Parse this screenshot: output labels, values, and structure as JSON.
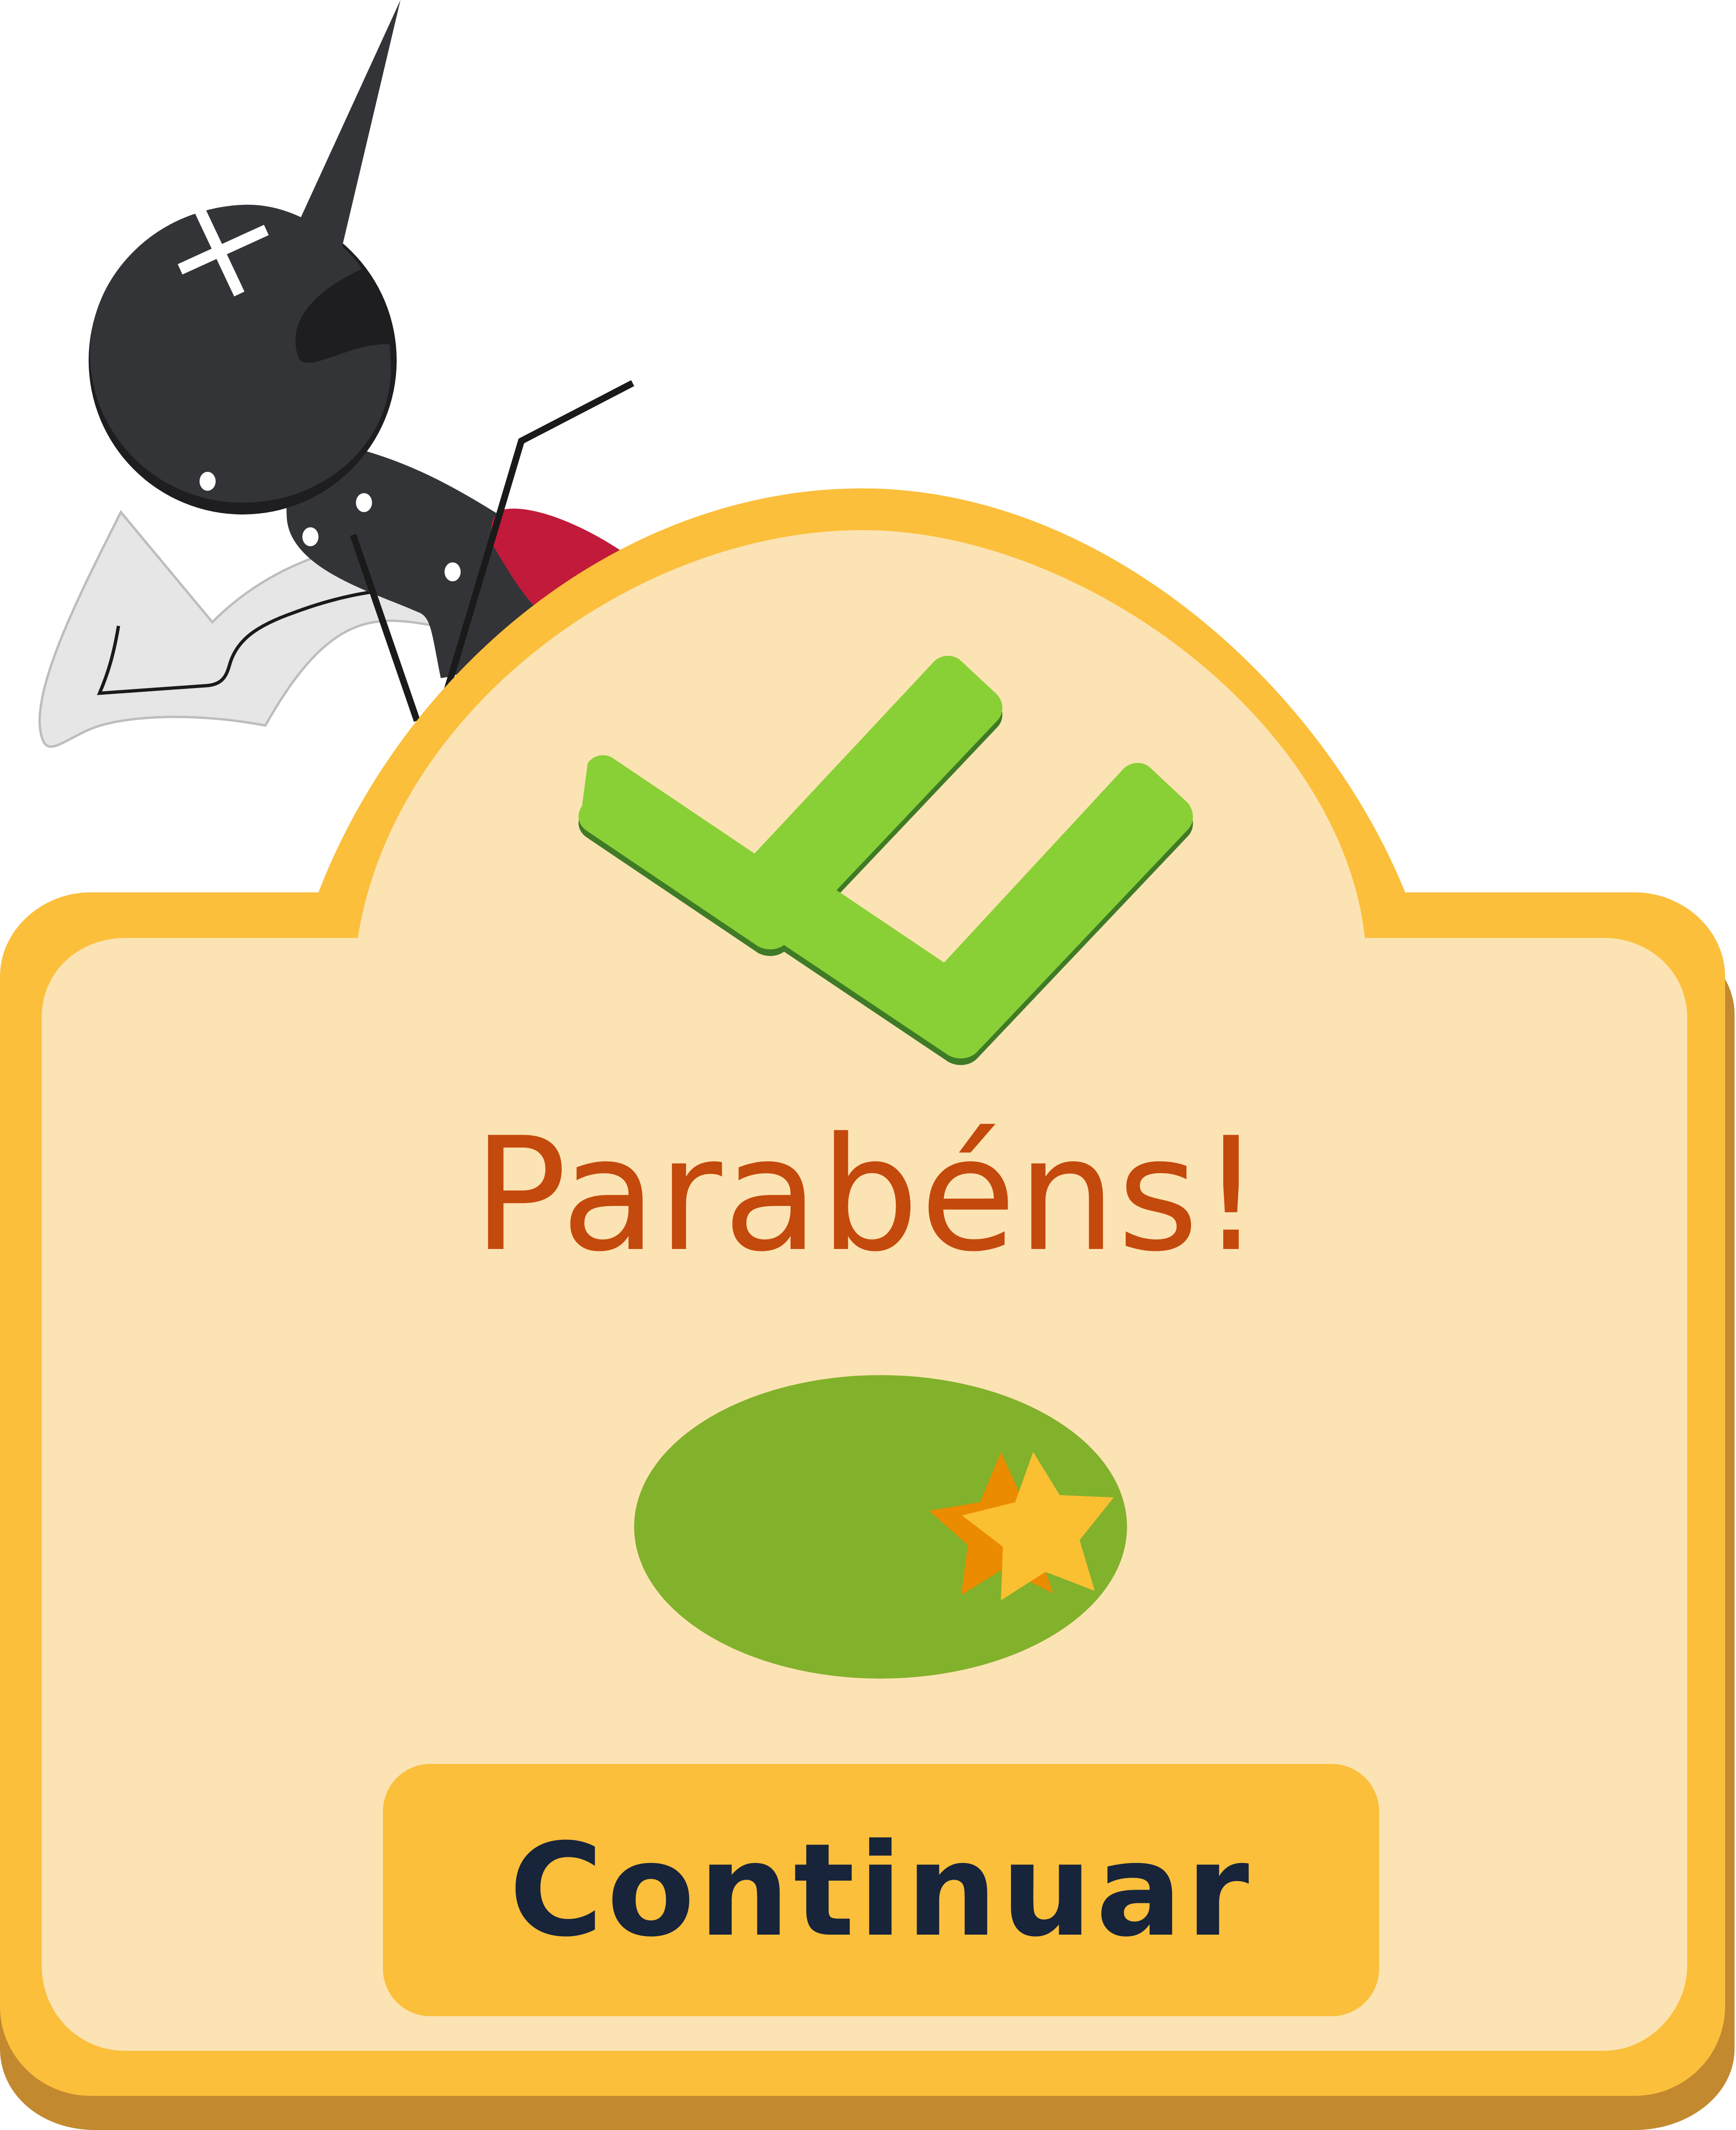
{
  "dialog": {
    "title": "Parabéns!",
    "continue_label": "Continuar"
  },
  "result": {
    "stars_earned": 2,
    "badge_color": "#82b12b",
    "star_colors": [
      "#eb8b00",
      "#fbbf32"
    ]
  },
  "colors": {
    "frame": "#fbbf3b",
    "frame_shadow": "#c2892f",
    "panel": "#fce3b3",
    "title": "#c4490c",
    "check": "#88d035",
    "check_shadow": "#3f7a26",
    "button_text": "#17243a"
  },
  "icons": {
    "checkmark": "double-check-icon",
    "mascot": "mosquito-icon",
    "stars": "star-icon"
  }
}
